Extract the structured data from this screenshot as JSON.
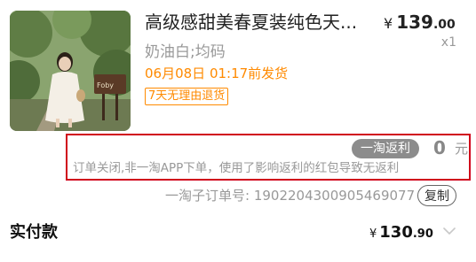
{
  "product": {
    "title": "高级感甜美春夏装纯色天...",
    "price": {
      "currency": "¥",
      "integer": "139",
      "decimal": ".00"
    },
    "quantity": "x1",
    "sku": "奶油白;均码",
    "ship_time": "06月08日 01:17前发货",
    "return_badge": "7天无理由退货",
    "image_sign_text": "Foby"
  },
  "rebate": {
    "tag": "一淘返利",
    "amount": "0",
    "unit": "元",
    "note": "订单关闭,非一淘APP下单，使用了影响返利的红包导致无返利"
  },
  "suborder": {
    "label": "一淘子订单号: 1902204300905469077",
    "copy_label": "复制"
  },
  "payment": {
    "label": "实付款",
    "price": {
      "currency": "¥",
      "integer": "130",
      "decimal": ".90"
    }
  },
  "colors": {
    "accent_orange": "#ff8a00",
    "highlight_red": "#d0021b",
    "tag_gray": "#8c8c8c"
  }
}
